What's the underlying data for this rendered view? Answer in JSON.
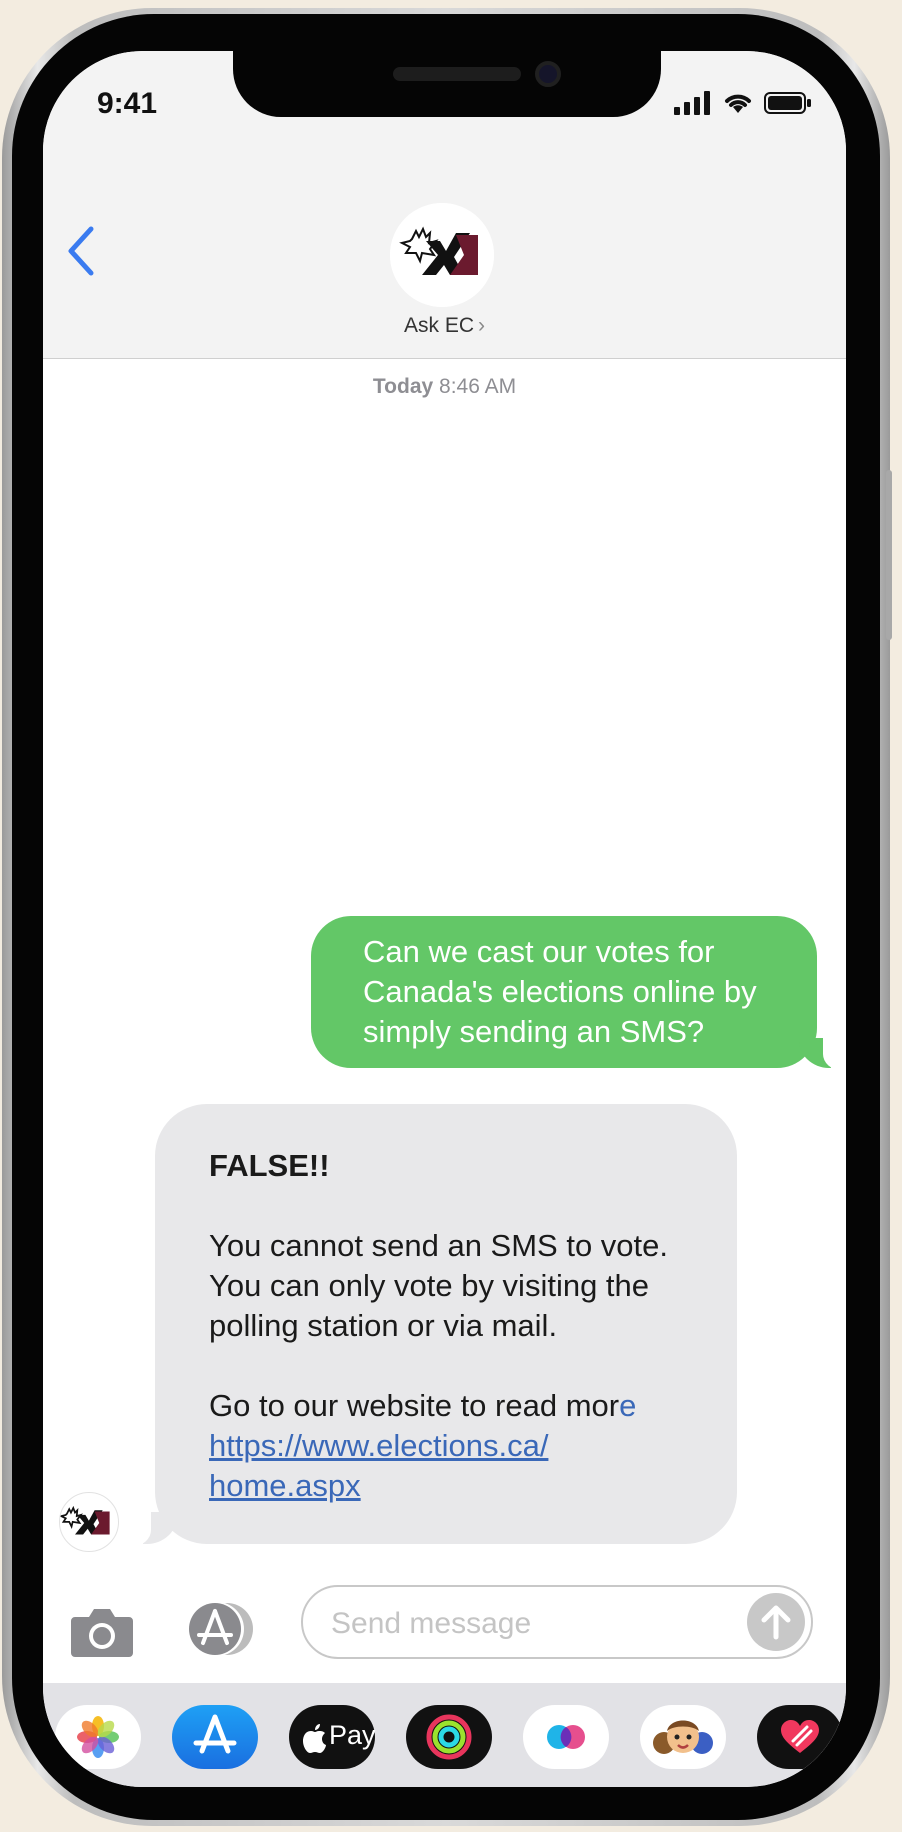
{
  "status_bar": {
    "time": "9:41"
  },
  "header": {
    "contact_name": "Ask EC",
    "chevron": "›"
  },
  "conversation": {
    "timestamp_day": "Today",
    "timestamp_time": "8:46 AM",
    "outgoing": {
      "text": "Can we cast our votes for Canada's elections online by simply sending an SMS?"
    },
    "incoming": {
      "heading": "FALSE!!",
      "body_line1": "You cannot send an SMS to vote.",
      "body_line2": "You can only vote by visiting the",
      "body_line3": "polling station or via mail.",
      "website_text": "Go to our website to read mor",
      "website_text_e": "e",
      "link_line1": "https://www.elections.ca/",
      "link_line2": "home.aspx"
    }
  },
  "composer": {
    "placeholder": "Send message"
  },
  "app_drawer": {
    "items": [
      "photos-app",
      "app-store-app",
      "apple-pay-app",
      "activity-app",
      "clips-app",
      "memoji-app",
      "digital-touch-app"
    ],
    "apple_pay_label": "Pay"
  },
  "colors": {
    "outgoing_bubble": "#63c767",
    "incoming_bubble": "#e8e8ea",
    "link": "#3a68b8",
    "ios_blue": "#3a7bf0",
    "logo_maroon": "#6b1a2e"
  }
}
